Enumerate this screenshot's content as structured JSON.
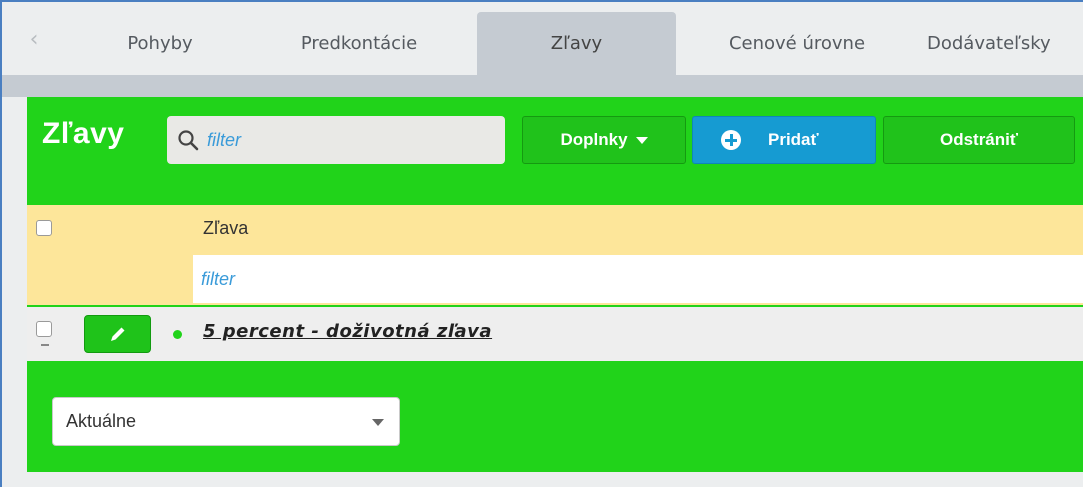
{
  "tabs": [
    {
      "label": "Pohyby"
    },
    {
      "label": "Predkontácie"
    },
    {
      "label": "Zľavy",
      "active": true
    },
    {
      "label": "Cenové úrovne"
    },
    {
      "label": "Dodávateľsky"
    }
  ],
  "panel": {
    "title": "Zľavy",
    "search_placeholder": "filter",
    "addons_label": "Doplnky",
    "add_label": "Pridať",
    "remove_label": "Odstrániť"
  },
  "table": {
    "column_header": "Zľava",
    "filter_placeholder": "filter",
    "rows": [
      {
        "name": "5 percent - doživotná zľava",
        "status": "active"
      }
    ]
  },
  "view_select": {
    "value": "Aktuálne"
  },
  "colors": {
    "panel_green": "#21d31a",
    "header_yellow": "#fde69a",
    "accent_blue": "#169bd2",
    "filter_text": "#3a9bd9"
  }
}
